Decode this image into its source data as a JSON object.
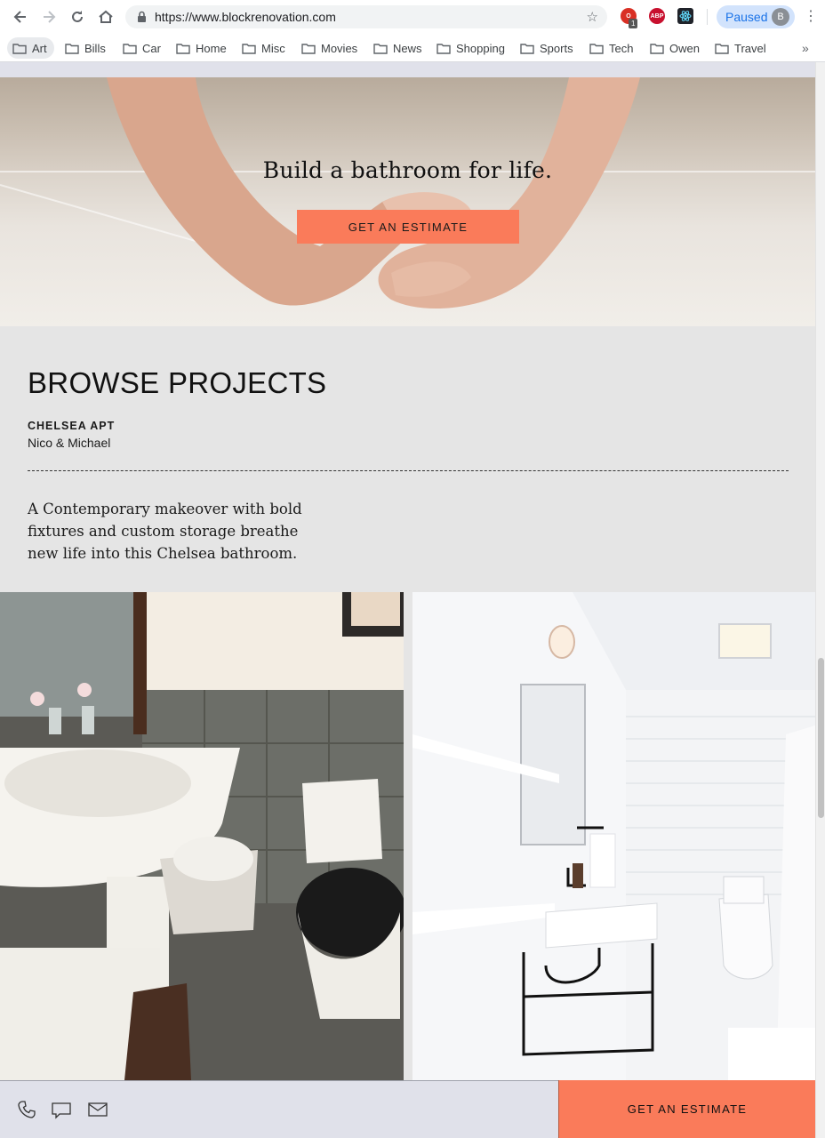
{
  "browser": {
    "url": "https://www.blockrenovation.com",
    "profile_label": "Paused",
    "profile_initial": "B",
    "extension_badge": "1",
    "abp_label": "ABP",
    "bookmarks": [
      "Art",
      "Bills",
      "Car",
      "Home",
      "Misc",
      "Movies",
      "News",
      "Shopping",
      "Sports",
      "Tech",
      "Owen",
      "Travel"
    ],
    "bookmarks_more": "»"
  },
  "hero": {
    "title": "Build a bathroom for life.",
    "cta_label": "GET AN ESTIMATE"
  },
  "browse": {
    "title": "BROWSE PROJECTS",
    "project_name": "CHELSEA APT",
    "project_owner": "Nico & Michael",
    "project_description": "A Contemporary makeover with bold fixtures and custom storage breathe new life into this Chelsea bathroom."
  },
  "footer": {
    "cta_label": "GET AN ESTIMATE",
    "icons": [
      "phone-icon",
      "chat-icon",
      "mail-icon"
    ]
  },
  "colors": {
    "accent": "#fa7b5a",
    "page_bg": "#e5e5e5",
    "footer_bg": "#e0e1ea"
  }
}
